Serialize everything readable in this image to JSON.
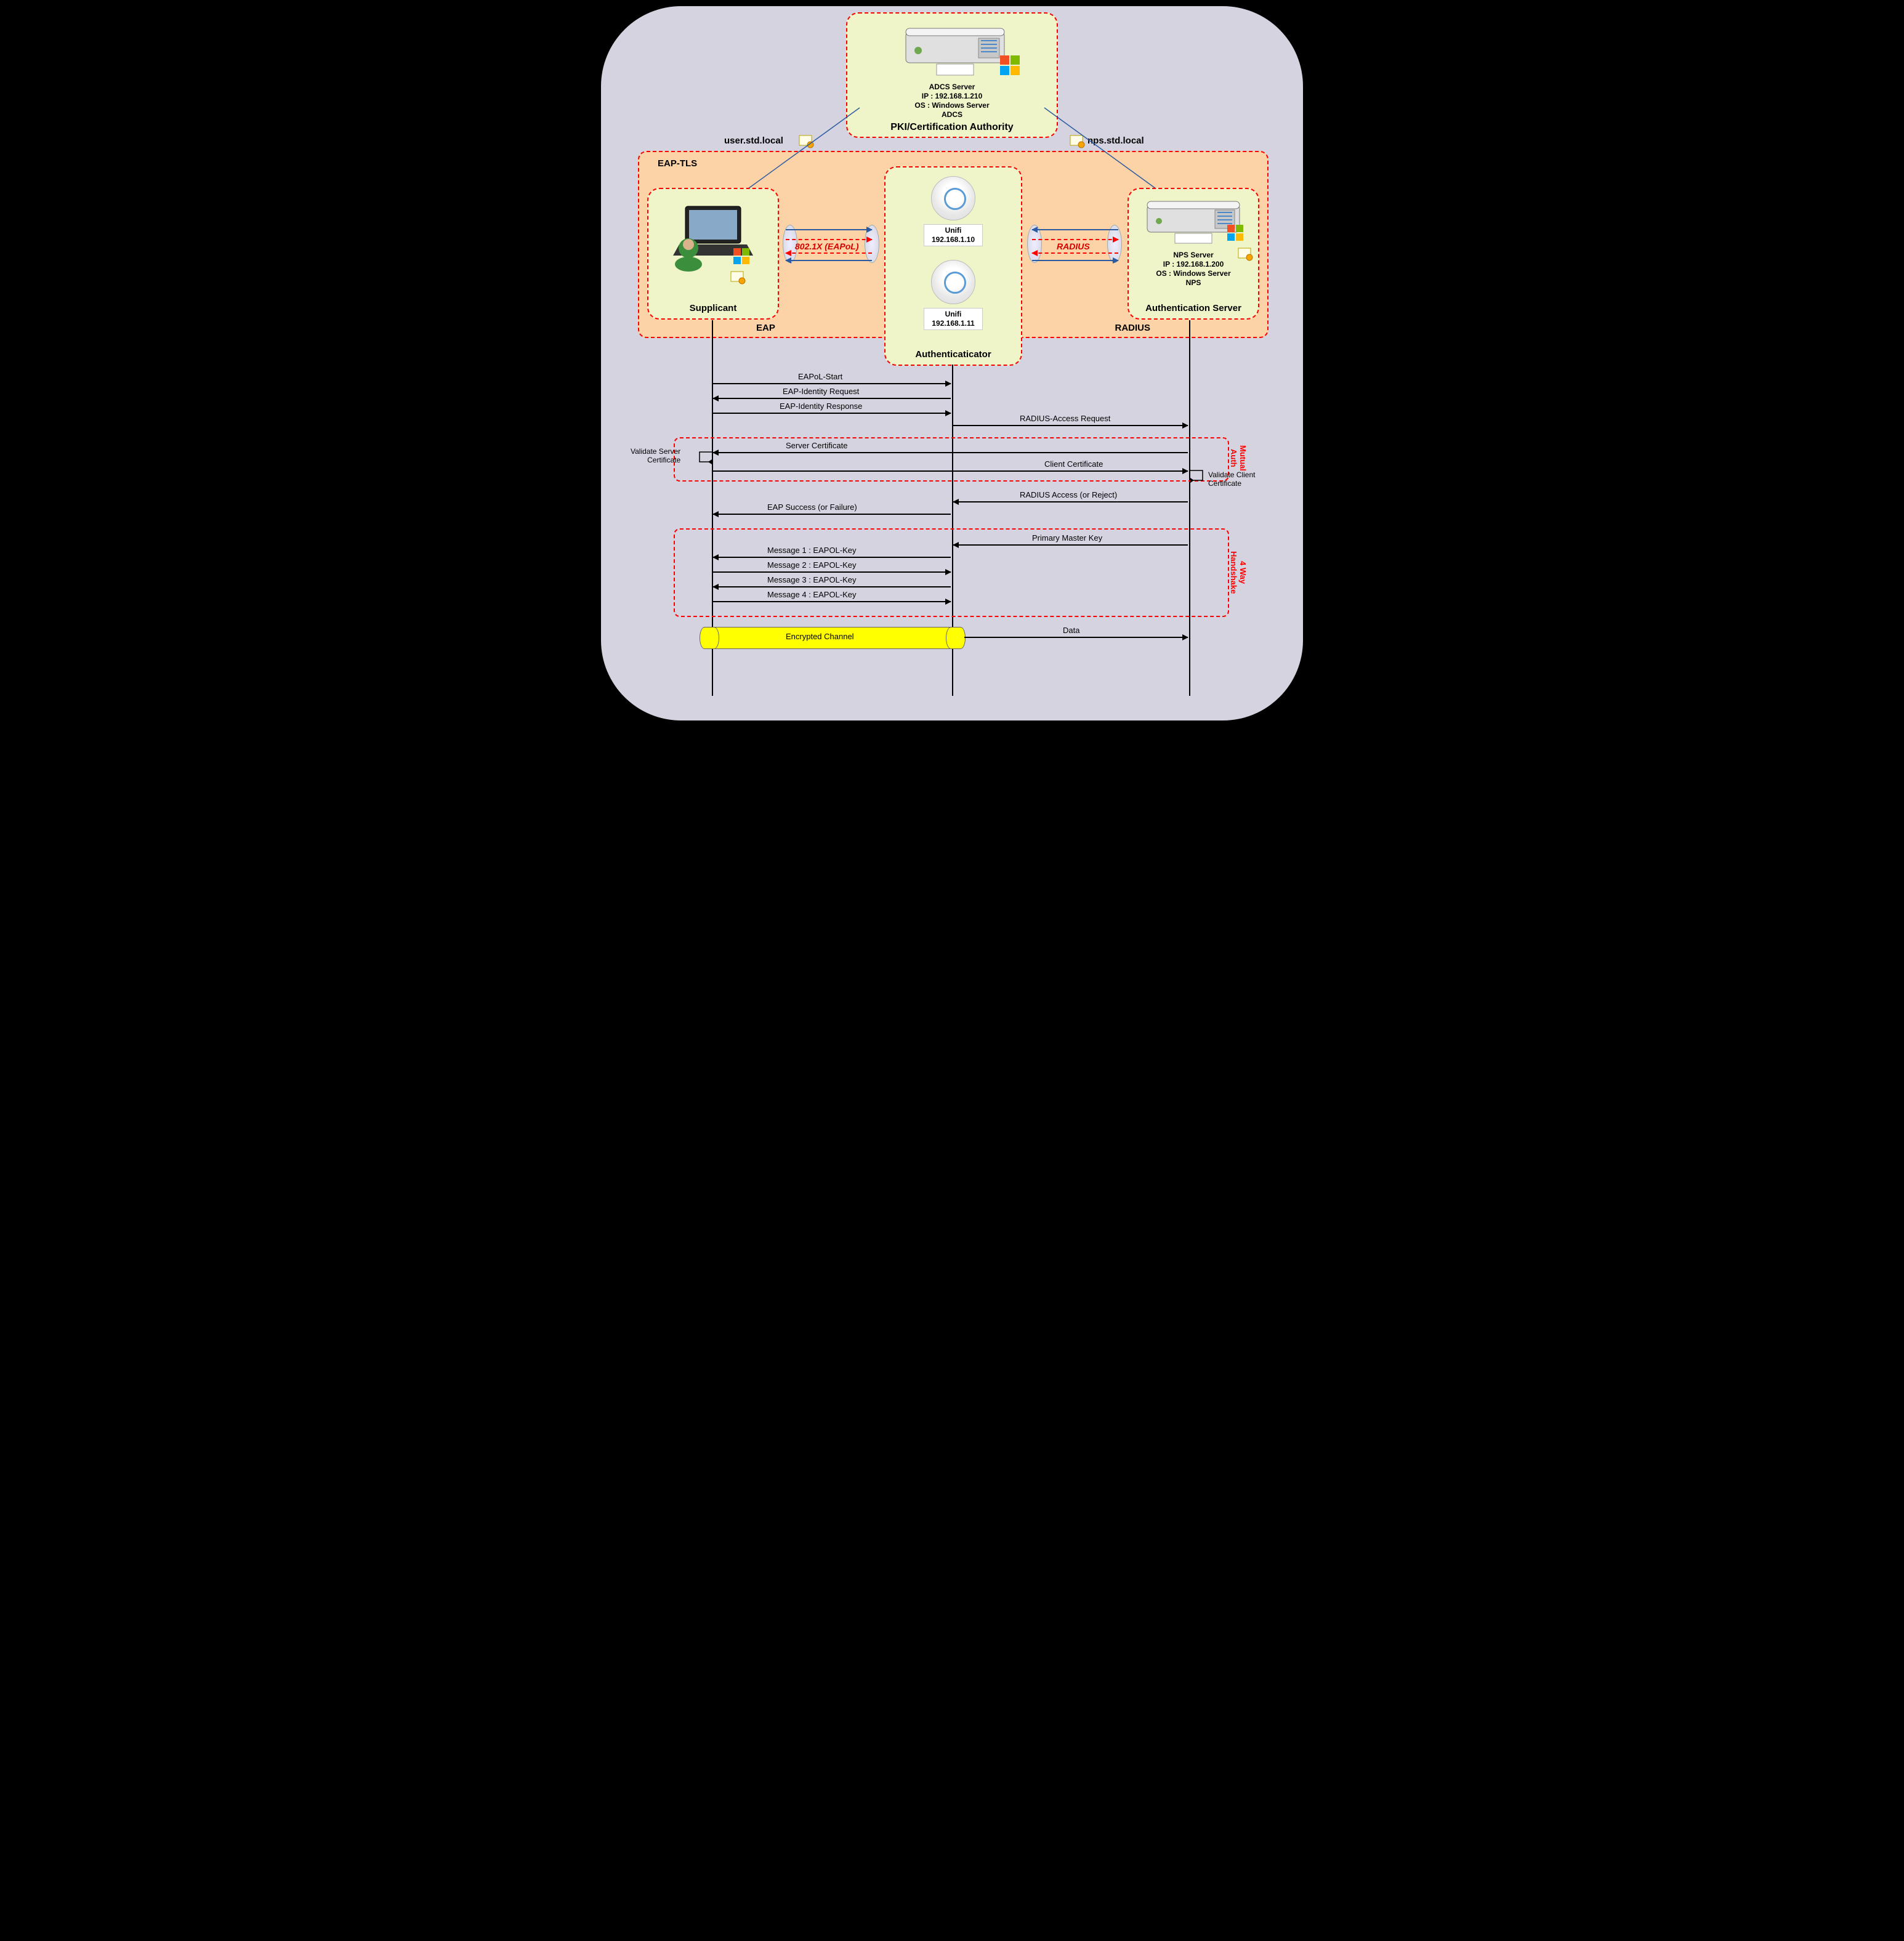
{
  "pki": {
    "title": "PKI/Certification Authority",
    "l1": "ADCS Server",
    "l2": "IP : 192.168.1.210",
    "l3": "OS : Windows Server",
    "l4": "ADCS"
  },
  "certs": {
    "user": "user.std.local",
    "nps": "nps.std.local"
  },
  "eaptls": "EAP-TLS",
  "supplicant": {
    "title": "Supplicant"
  },
  "authenticator": {
    "title": "Authenticaticator",
    "ap1": {
      "name": "Unifi",
      "ip": "192.168.1.10"
    },
    "ap2": {
      "name": "Unifi",
      "ip": "192.168.1.11"
    }
  },
  "authserver": {
    "title": "Authentication Server",
    "l1": "NPS Server",
    "l2": "IP : 192.168.1.200",
    "l3": "OS : Windows Server",
    "l4": "NPS"
  },
  "proto": {
    "eapol": "802.1X (EAPoL)",
    "radius": "RADIUS",
    "eap": "EAP",
    "radius2": "RADIUS"
  },
  "seq": {
    "s1": "EAPoL-Start",
    "s2": "EAP-Identity Request",
    "s3": "EAP-Identity Response",
    "s4": "RADIUS-Access Request",
    "s5": "Server Certificate",
    "s6": "Client Certificate",
    "s7": "RADIUS Access (or Reject)",
    "s8": "EAP Success (or Failure)",
    "s9": "Primary Master Key",
    "m1": "Message 1 : EAPOL-Key",
    "m2": "Message 2 : EAPOL-Key",
    "m3": "Message 3 : EAPOL-Key",
    "m4": "Message 4 : EAPOL-Key",
    "enc": "Encrypted Channel",
    "data": "Data"
  },
  "notes": {
    "valserver": "Validate Server\nCertificate",
    "valclient": "Validate Client\nCertificate",
    "mutual": "Mutual\nAuth",
    "fourway": "4 Way\nHandshake"
  }
}
